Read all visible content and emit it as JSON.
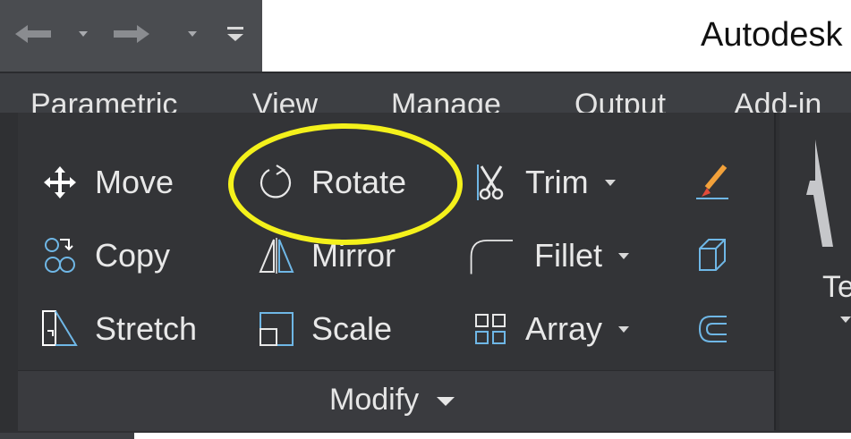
{
  "app": {
    "title": "Autodesk"
  },
  "qat": {
    "undo_icon": "undo-arrow-icon",
    "redo_icon": "redo-arrow-icon",
    "customize_icon": "qat-customize-icon"
  },
  "tabs": [
    {
      "label": "Parametric"
    },
    {
      "label": "View"
    },
    {
      "label": "Manage"
    },
    {
      "label": "Output"
    },
    {
      "label": "Add-in"
    }
  ],
  "modify_panel": {
    "label": "Modify",
    "col1": [
      {
        "label": "Move",
        "icon": "move-icon"
      },
      {
        "label": "Copy",
        "icon": "copy-icon"
      },
      {
        "label": "Stretch",
        "icon": "stretch-icon"
      }
    ],
    "col2": [
      {
        "label": "Rotate",
        "icon": "rotate-icon"
      },
      {
        "label": "Mirror",
        "icon": "mirror-icon"
      },
      {
        "label": "Scale",
        "icon": "scale-icon"
      }
    ],
    "col3": [
      {
        "label": "Trim",
        "icon": "trim-scissors-icon"
      },
      {
        "label": "Fillet",
        "icon": "fillet-icon"
      },
      {
        "label": "Array",
        "icon": "array-icon"
      }
    ],
    "col4_icons": [
      "erase-icon",
      "explode-icon",
      "offset-icon"
    ]
  },
  "annotation_panel": {
    "label_partial": "Te"
  },
  "colors": {
    "ribbon_bg": "#333437",
    "tab_bar_bg": "#3d3f43",
    "qat_bg": "#4a4c50",
    "highlight": "#f4f11b",
    "icon_blue": "#6fb7e6",
    "icon_orange": "#f2a13a"
  }
}
